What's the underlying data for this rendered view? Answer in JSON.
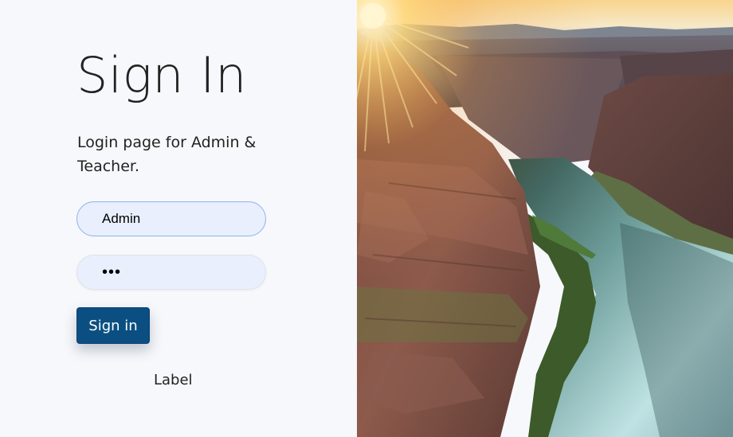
{
  "login": {
    "title": "Sign In",
    "subtitle": "Login page for Admin & Teacher.",
    "username_value": "Admin",
    "password_value": "aaa",
    "signin_label": "Sign in",
    "bottom_label": "Label"
  },
  "colors": {
    "background": "#f7f8fb",
    "field_fill": "#e9effd",
    "button_fill": "#0b4f82",
    "button_text": "#ffffff"
  },
  "image": {
    "subject": "canyon-river-sunrise-photo"
  }
}
